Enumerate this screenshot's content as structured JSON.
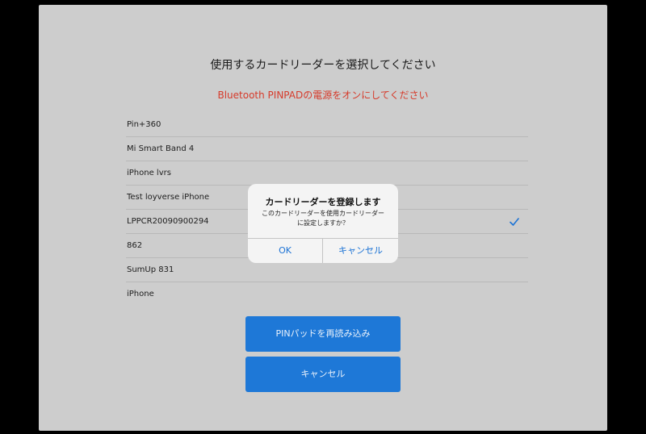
{
  "screen": {
    "title": "使用するカードリーダーを選択してください",
    "warning": "Bluetooth PINPADの電源をオンにしてください",
    "warning_color": "#d63a2a"
  },
  "readers": [
    {
      "label": "Pin+360",
      "selected": false
    },
    {
      "label": "Mi Smart Band 4",
      "selected": false
    },
    {
      "label": "iPhone lvrs",
      "selected": false
    },
    {
      "label": "Test loyverse iPhone",
      "selected": false
    },
    {
      "label": "LPPCR20090900294",
      "selected": true
    },
    {
      "label": "862",
      "selected": false
    },
    {
      "label": "SumUp 831",
      "selected": false
    },
    {
      "label": "iPhone",
      "selected": false
    }
  ],
  "buttons": {
    "reload_label": "PINパッドを再読み込み",
    "cancel_label": "キャンセル",
    "color": "#1e78d7"
  },
  "dialog": {
    "title": "カードリーダーを登録します",
    "message_line1": "このカードリーダーを使用カードリーダー",
    "message_line2": "に設定しますか？",
    "ok_label": "OK",
    "cancel_label": "キャンセル",
    "accent": "#1c73d5"
  },
  "icons": {
    "selected": "checkmark-icon"
  }
}
